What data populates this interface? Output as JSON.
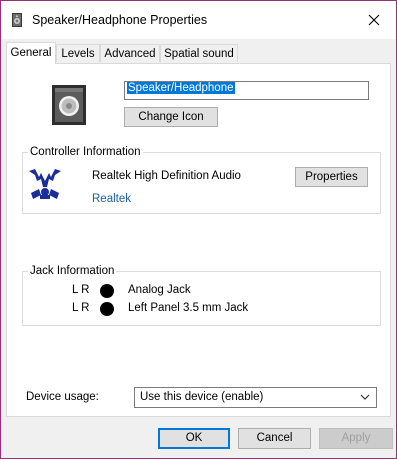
{
  "window": {
    "title": "Speaker/Headphone Properties",
    "close_glyph": "✕",
    "border_color": "#9b2e78"
  },
  "tabs": [
    {
      "label": "General",
      "active": true
    },
    {
      "label": "Levels",
      "active": false
    },
    {
      "label": "Advanced",
      "active": false
    },
    {
      "label": "Spatial sound",
      "active": false
    }
  ],
  "general": {
    "device_name": "Speaker/Headphone",
    "change_icon_label": "Change Icon",
    "controller": {
      "group_label": "Controller Information",
      "name": "Realtek High Definition Audio",
      "vendor_link": "Realtek",
      "properties_label": "Properties"
    },
    "jack": {
      "group_label": "Jack Information",
      "rows": [
        {
          "channels": "L R",
          "label": "Analog Jack"
        },
        {
          "channels": "L R",
          "label": "Left Panel 3.5 mm Jack"
        }
      ]
    },
    "device_usage": {
      "label": "Device usage:",
      "selected": "Use this device (enable)"
    }
  },
  "footer": {
    "ok_label": "OK",
    "cancel_label": "Cancel",
    "apply_label": "Apply",
    "apply_enabled": false
  },
  "icons": {
    "title": "speaker-icon",
    "device": "speaker-icon",
    "controller": "realtek-logo-icon",
    "jack": "jack-dot-icon",
    "close": "close-icon",
    "dropdown": "chevron-down-icon"
  },
  "colors": {
    "accent": "#0078d7",
    "link": "#1b5fa3",
    "realtek_blue": "#1a2d9b"
  }
}
